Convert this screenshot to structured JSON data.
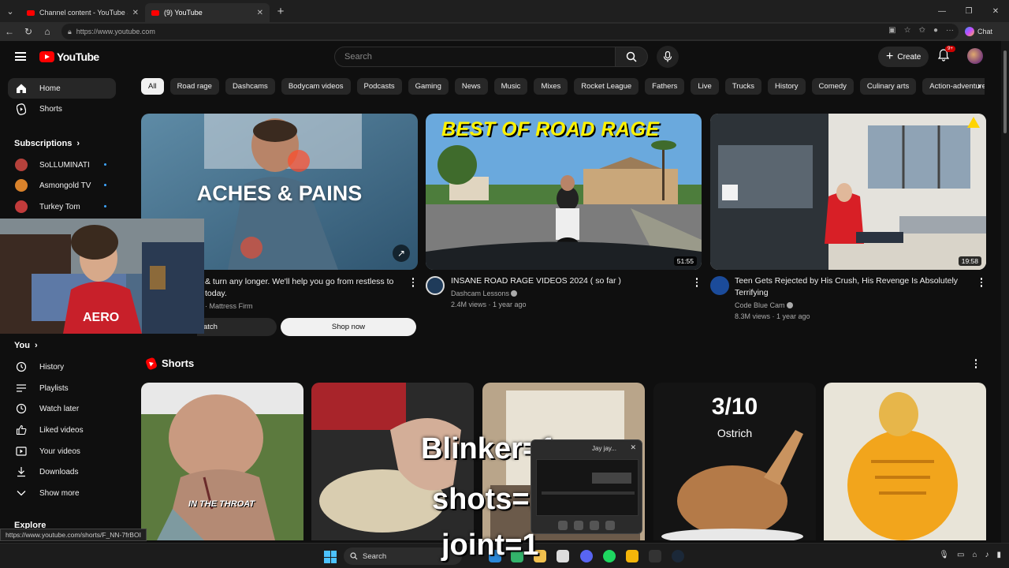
{
  "browser": {
    "tabs": [
      {
        "label": "Channel content - YouTube Studio",
        "active": false
      },
      {
        "label": "(9) YouTube",
        "active": true
      }
    ],
    "url": "https://www.youtube.com",
    "chat_label": "Chat"
  },
  "header": {
    "logo_text": "YouTube",
    "search_placeholder": "Search",
    "create_label": "Create",
    "notification_count": "9+"
  },
  "sidebar": {
    "main": [
      {
        "label": "Home",
        "icon": "home-icon",
        "active": true
      },
      {
        "label": "Shorts",
        "icon": "shorts-icon",
        "active": false
      }
    ],
    "subscriptions_heading": "Subscriptions",
    "subscriptions": [
      {
        "label": "SoLLUMINATI",
        "color": "#b5413b"
      },
      {
        "label": "Asmongold TV",
        "color": "#d9822b"
      },
      {
        "label": "Turkey Tom",
        "color": "#c23b3b"
      }
    ],
    "you_heading": "You",
    "you_items": [
      {
        "label": "History",
        "icon": "history-icon"
      },
      {
        "label": "Playlists",
        "icon": "playlists-icon"
      },
      {
        "label": "Watch later",
        "icon": "clock-icon"
      },
      {
        "label": "Liked videos",
        "icon": "thumbs-up-icon"
      },
      {
        "label": "Your videos",
        "icon": "video-icon"
      },
      {
        "label": "Downloads",
        "icon": "download-icon"
      },
      {
        "label": "Show more",
        "icon": "chevron-down-icon"
      }
    ],
    "explore_heading": "Explore"
  },
  "chips": [
    "All",
    "Road rage",
    "Dashcams",
    "Bodycam videos",
    "Podcasts",
    "Gaming",
    "News",
    "Music",
    "Mixes",
    "Rocket League",
    "Fathers",
    "Live",
    "Trucks",
    "History",
    "Comedy",
    "Culinary arts",
    "Action-adventure gam"
  ],
  "videos": {
    "ad": {
      "thumb_text": "ACHES & PAINS",
      "title": "& turn any longer. We'll help you go from restless to today.",
      "channel": "· Mattress Firm",
      "watch_label": "atch",
      "shop_label": "Shop now"
    },
    "v2": {
      "thumb_text": "BEST OF ROAD RAGE",
      "duration": "51:55",
      "title": "INSANE ROAD RAGE VIDEOS 2024 ( so far )",
      "channel": "Dashcam Lessons",
      "meta": "2.4M views · 1 year ago"
    },
    "v3": {
      "duration": "19:58",
      "title": "Teen Gets Rejected by His Crush, His Revenge Is Absolutely Terrifying",
      "channel": "Code Blue Cam",
      "meta": "8.3M views · 1 year ago"
    }
  },
  "shorts": {
    "heading": "Shorts",
    "items": [
      {
        "caption": "IN THE THROAT"
      },
      {
        "caption": ""
      },
      {
        "caption": ""
      },
      {
        "caption": "3/10",
        "subcaption": "Ostrich"
      },
      {
        "caption": ""
      }
    ]
  },
  "overlay": {
    "lines": [
      "Blinker=1",
      "shots=1",
      "joint=1"
    ],
    "popup_title": "Jay jay..."
  },
  "status_url": "https://www.youtube.com/shorts/F_NN-7frBOI",
  "taskbar": {
    "search_label": "Search"
  }
}
